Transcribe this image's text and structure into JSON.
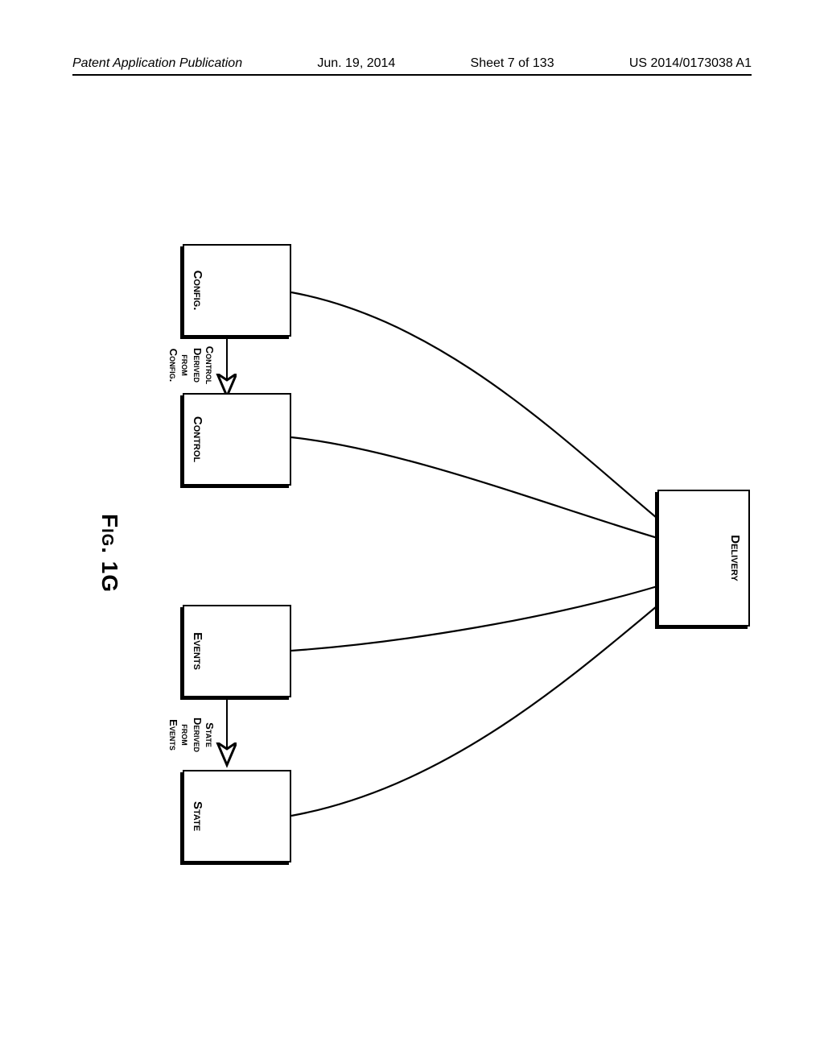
{
  "header": {
    "left": "Patent Application Publication",
    "date": "Jun. 19, 2014",
    "sheet": "Sheet 7 of 133",
    "pubno": "US 2014/0173038 A1"
  },
  "boxes": {
    "delivery": "Delivery",
    "config": "Config.",
    "control": "Control",
    "events": "Events",
    "state": "State"
  },
  "arrows": {
    "control_derived": "Control\nDerived\nfrom\nConfig.",
    "state_derived": "State\nDerived\nfrom\nEvents"
  },
  "figure_caption": "Fig. 1G"
}
